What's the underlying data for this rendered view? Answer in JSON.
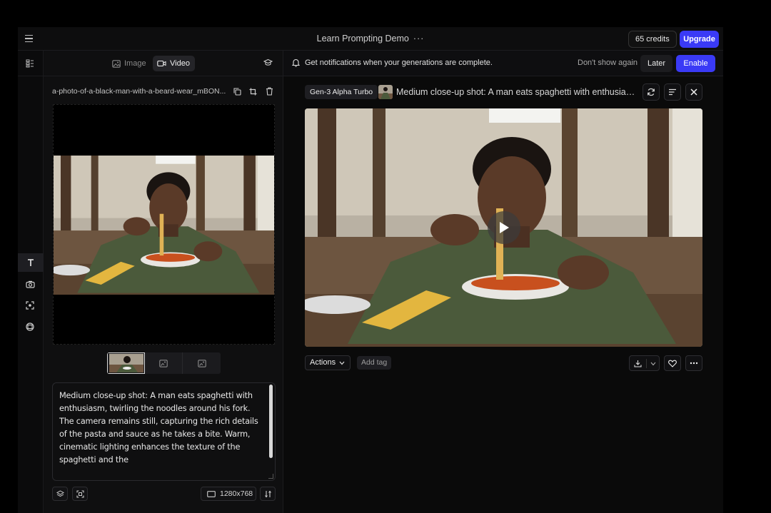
{
  "app": {
    "title": "Learn Prompting Demo",
    "more": "···",
    "credits": "65 credits",
    "upgrade_label": "Upgrade",
    "accent_color": "#3a3af6"
  },
  "icons": {
    "menu": "hamburger-icon",
    "rail": [
      "sidebar-toggle-icon",
      "text-icon",
      "camera-icon",
      "motion-icon",
      "frame-icon"
    ]
  },
  "left_panel": {
    "tabs": [
      {
        "label": "Image",
        "icon": "image-icon",
        "active": false
      },
      {
        "label": "Video",
        "icon": "video-icon",
        "active": true
      }
    ],
    "filename": "a-photo-of-a-black-man-with-a-beard-wear_mBON...",
    "prompt": "Medium close-up shot: A man eats spaghetti with enthusiasm, twirling the noodles around his fork. The camera remains still, capturing the rich details of the pasta and sauce as he takes a bite. Warm, cinematic lighting enhances the texture of the spaghetti and the",
    "resolution": "1280x768"
  },
  "notification": {
    "text": "Get notifications when your generations are complete.",
    "dont_show": "Don't show again",
    "later": "Later",
    "enable": "Enable"
  },
  "generation": {
    "model": "Gen-3 Alpha Turbo",
    "title": "Medium close-up shot: A man eats spaghetti with enthusiasm, twirling the noodles around his fork.",
    "actions_label": "Actions",
    "add_tag": "Add tag"
  }
}
